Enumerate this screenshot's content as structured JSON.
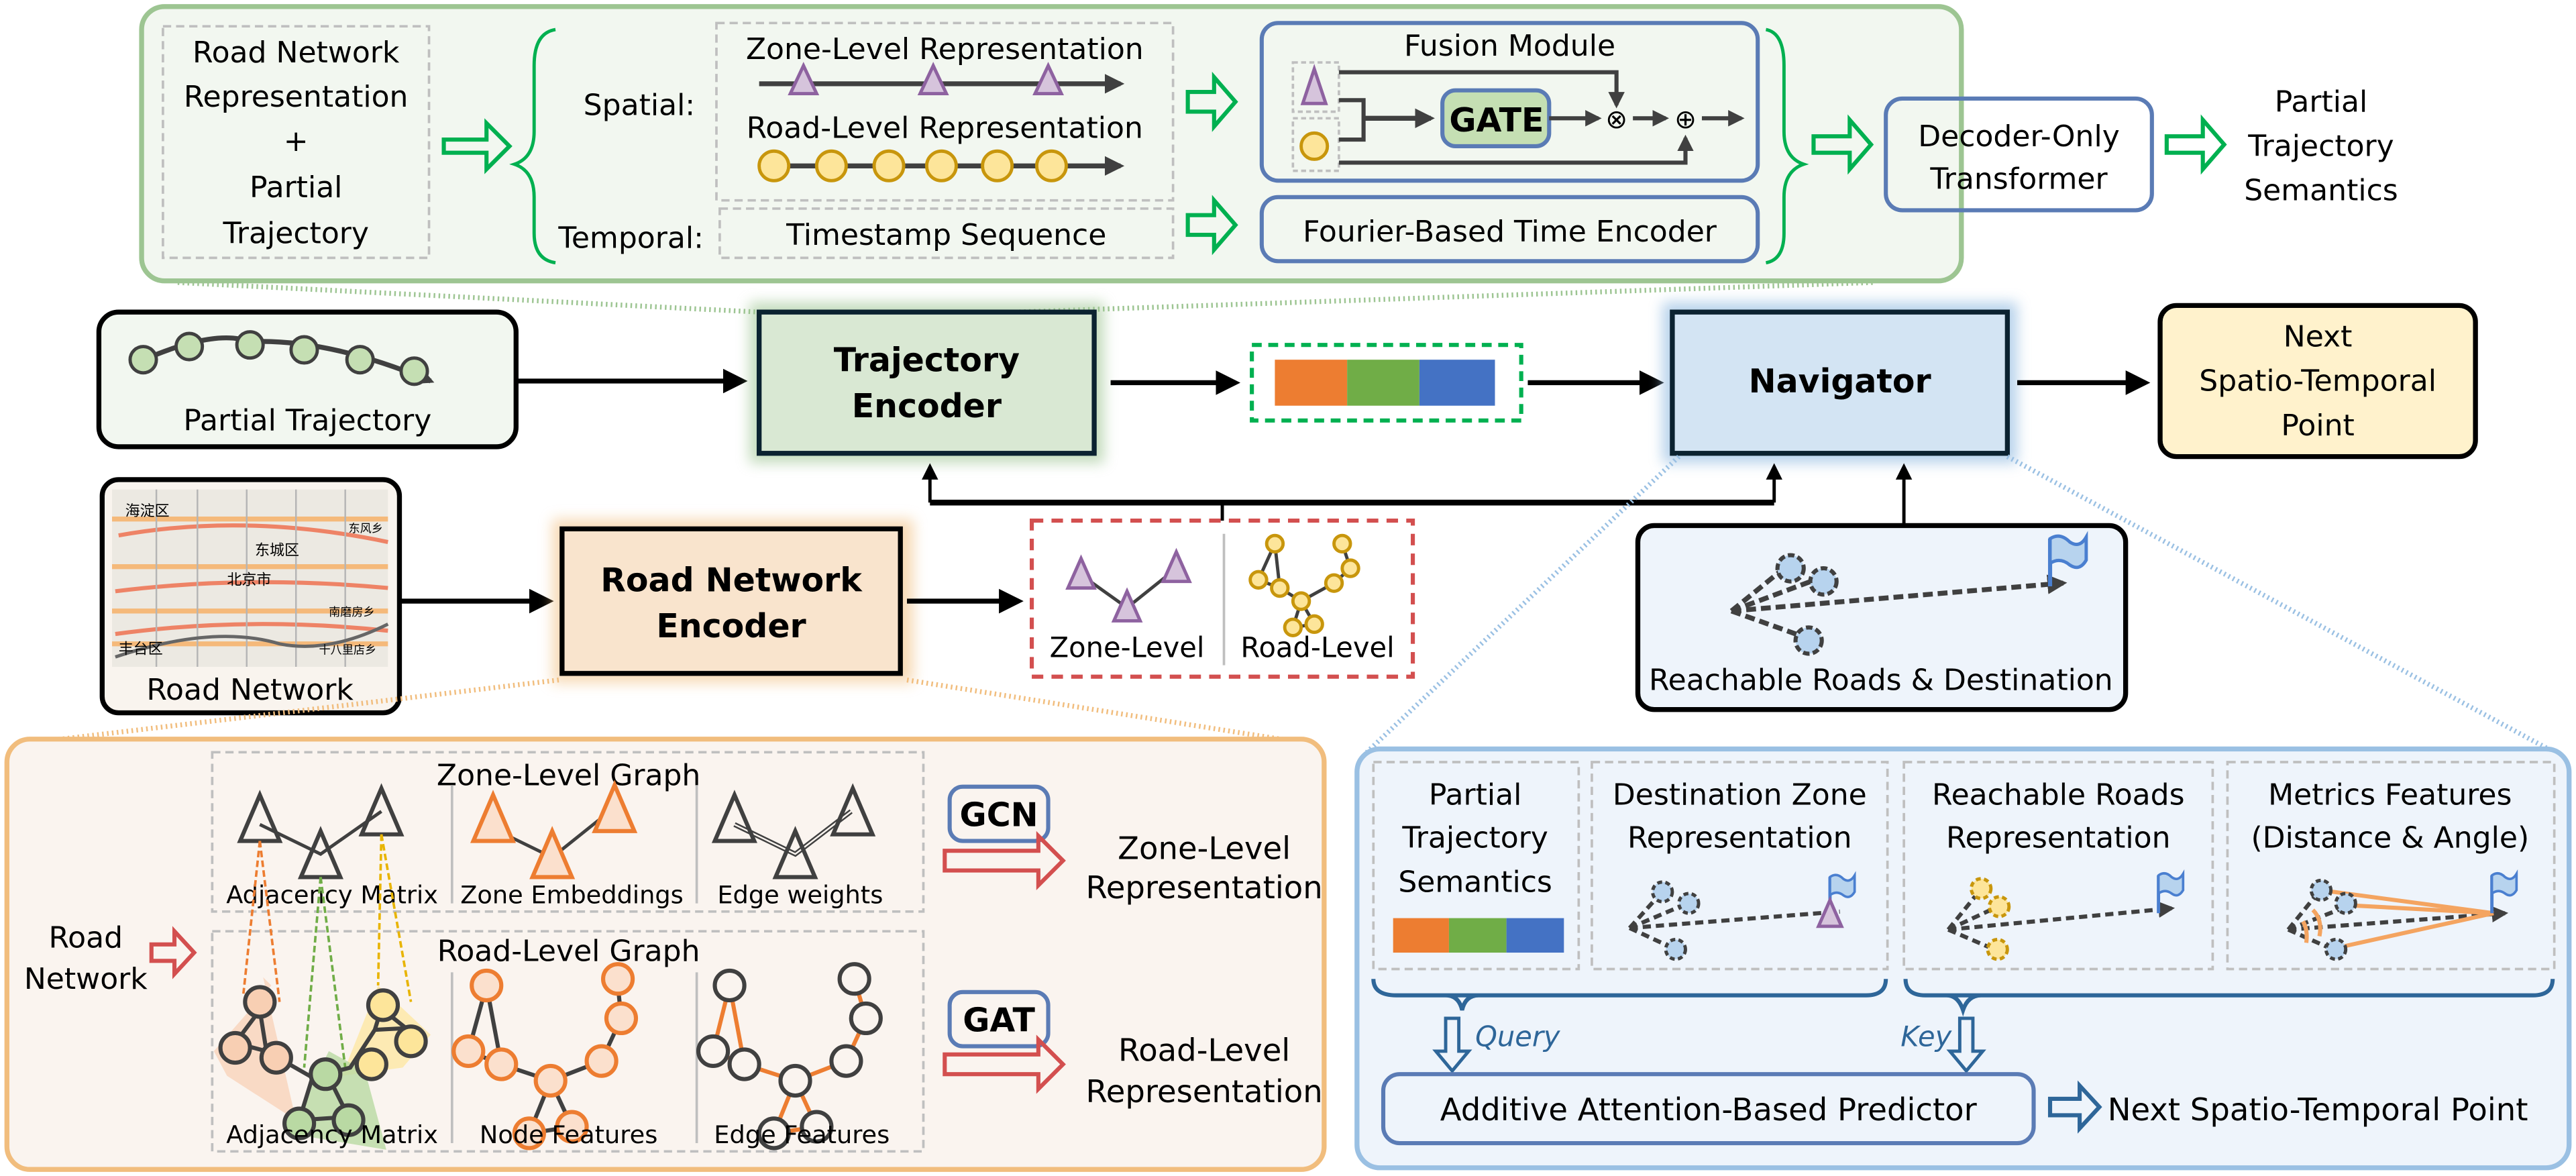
{
  "colors": {
    "green_panel_border": "#9dc592",
    "green_panel_fill": "#f2f7f0",
    "green_arrow": "#00b050",
    "blue_box_border": "#5a7bb5",
    "gate_fill": "#c5dfb3",
    "traj_encoder_fill": "#d9e8d3",
    "navigator_fill": "#d3e4f3",
    "next_point_fill": "#fff2cc",
    "road_encoder_fill": "#f9e4cd",
    "orange_panel_border": "#f1bd7d",
    "orange_panel_fill": "#faf4ef",
    "blue_panel_border": "#9ac0e3",
    "blue_panel_fill": "#eef4fb",
    "red_dashed": "#d34f4f",
    "emb_orange": "#ed7d31",
    "emb_green": "#70ad47",
    "emb_blue": "#4472c4",
    "zone_purple": "#8e62a0",
    "zone_purple_fill": "#d6c4dc",
    "road_gold": "#c8960c",
    "road_gold_fill": "#fde59a",
    "flag_blue": "#4a7fd0",
    "query_key_blue": "#2e6699"
  },
  "top_panel": {
    "input_box": [
      "Road Network",
      "Representation",
      "+",
      "Partial",
      "Trajectory"
    ],
    "spatial_label": "Spatial:",
    "temporal_label": "Temporal:",
    "zone_level_rep": "Zone-Level Representation",
    "road_level_rep": "Road-Level Representation",
    "timestamp_seq": "Timestamp Sequence",
    "fusion_module": "Fusion Module",
    "gate": "GATE",
    "multiply_symbol": "⊗",
    "add_symbol": "⊕",
    "fourier_encoder": "Fourier-Based Time Encoder",
    "decoder": [
      "Decoder-Only",
      "Transformer"
    ],
    "output": [
      "Partial",
      "Trajectory",
      "Semantics"
    ]
  },
  "middle": {
    "partial_trajectory": "Partial Trajectory",
    "trajectory_encoder": [
      "Trajectory",
      "Encoder"
    ],
    "navigator": "Navigator",
    "next_point": [
      "Next",
      "Spatio-Temporal",
      "Point"
    ],
    "road_network": "Road Network",
    "road_network_encoder": [
      "Road Network",
      "Encoder"
    ],
    "zone_level": "Zone-Level",
    "road_level": "Road-Level",
    "reachable": "Reachable Roads & Destination",
    "map_labels": [
      "海淀区",
      "东风乡",
      "东城区",
      "北京市",
      "南磨房乡",
      "丰台区",
      "十八里店乡"
    ]
  },
  "bottom_left": {
    "road_network_input": [
      "Road",
      "Network"
    ],
    "zone_graph_title": "Zone-Level Graph",
    "road_graph_title": "Road-Level Graph",
    "zone_cols": [
      "Adjacency Matrix",
      "Zone Embeddings",
      "Edge weights"
    ],
    "road_cols": [
      "Adjacency Matrix",
      "Node Features",
      "Edge Features"
    ],
    "gcn": "GCN",
    "gat": "GAT",
    "zone_output": [
      "Zone-Level",
      "Representation"
    ],
    "road_output": [
      "Road-Level",
      "Representation"
    ]
  },
  "bottom_right": {
    "pts": [
      "Partial",
      "Trajectory",
      "Semantics"
    ],
    "dest_zone": [
      "Destination Zone",
      "Representation"
    ],
    "reachable_roads": [
      "Reachable Roads",
      "Representation"
    ],
    "metrics": [
      "Metrics Features",
      "(Distance & Angle)"
    ],
    "query": "Query",
    "key": "Key",
    "predictor": "Additive Attention-Based Predictor",
    "output": "Next Spatio-Temporal Point"
  }
}
